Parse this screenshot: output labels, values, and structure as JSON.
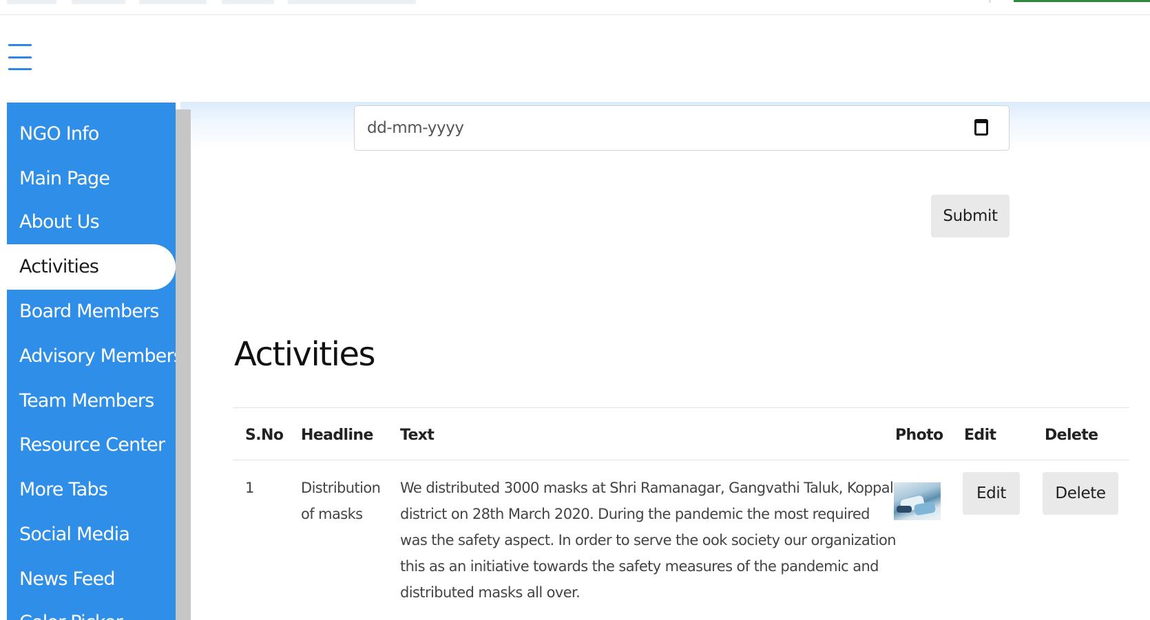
{
  "sidebar": {
    "items": [
      {
        "label": "NGO Info"
      },
      {
        "label": "Main Page"
      },
      {
        "label": "About Us"
      },
      {
        "label": "Activities"
      },
      {
        "label": "Board Members"
      },
      {
        "label": "Advisory Members"
      },
      {
        "label": "Team Members"
      },
      {
        "label": "Resource Center"
      },
      {
        "label": "More Tabs"
      },
      {
        "label": "Social Media"
      },
      {
        "label": "News Feed"
      },
      {
        "label": "Color Picker"
      }
    ],
    "active_label": "Activities"
  },
  "form": {
    "date_placeholder": "dd-mm-yyyy",
    "submit_label": "Submit"
  },
  "main": {
    "heading": "Activities"
  },
  "table": {
    "columns": [
      "S.No",
      "Headline",
      "Text",
      "Photo",
      "Edit",
      "Delete"
    ],
    "rows": [
      {
        "sno": "1",
        "headline_line1": "Distribution",
        "headline_line2": "of masks",
        "text_lines": [
          "We distributed 3000 masks at Shri Ramanagar, Gangvathi Taluk, Koppal",
          "district on 28th March 2020. During the pandemic the most required",
          "was the safety aspect. In order to serve the ook society our organization",
          "this as an initiative towards the safety measures of the pandemic and",
          "distributed masks all over."
        ],
        "edit_label": "Edit",
        "delete_label": "Delete"
      }
    ]
  },
  "colors": {
    "sidebar_bg": "#2f8fe8",
    "accent": "#2f86e4",
    "button_bg": "#e9e9e9"
  }
}
